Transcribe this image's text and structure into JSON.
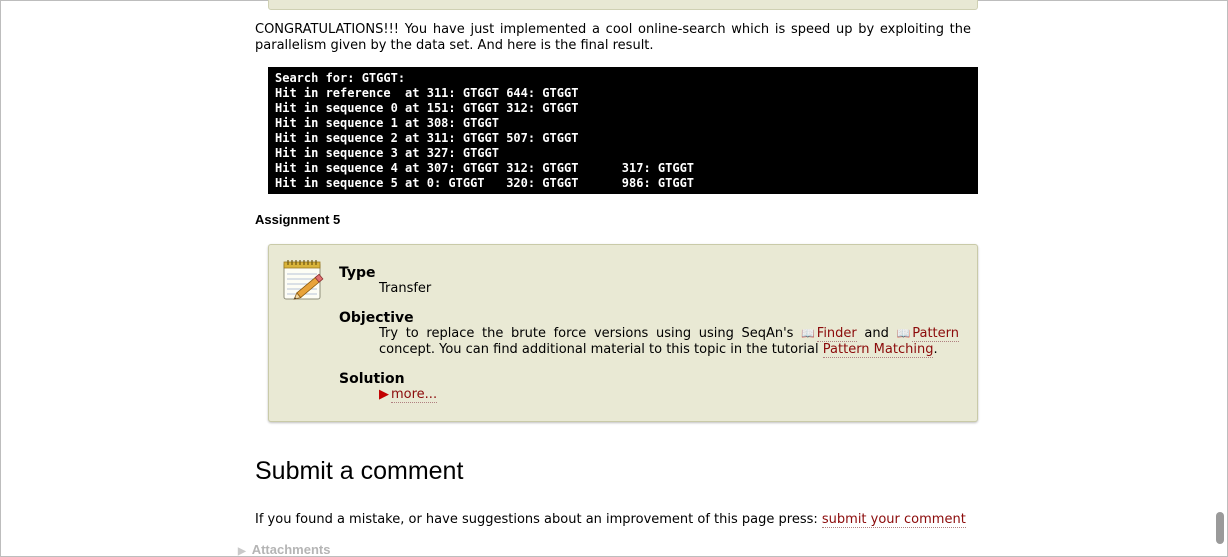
{
  "intro_paragraph": "CONGRATULATIONS!!! You have just implemented a cool online-search which is speed up by exploiting the parallelism given by the data set. And here is the final result.",
  "terminal": {
    "lines": [
      "Search for: GTGGT:",
      "Hit in reference  at 311: GTGGT 644: GTGGT",
      "Hit in sequence 0 at 151: GTGGT 312: GTGGT",
      "Hit in sequence 1 at 308: GTGGT",
      "Hit in sequence 2 at 311: GTGGT 507: GTGGT",
      "Hit in sequence 3 at 327: GTGGT",
      "Hit in sequence 4 at 307: GTGGT 312: GTGGT      317: GTGGT",
      "Hit in sequence 5 at 0: GTGGT   320: GTGGT      986: GTGGT"
    ]
  },
  "assignment": {
    "heading": "Assignment 5",
    "type_label": "Type",
    "type_value": "Transfer",
    "objective_label": "Objective",
    "objective_prefix": "Try to replace the brute force versions using using SeqAn's",
    "finder_link": "Finder",
    "and_text": "and",
    "pattern_link": "Pattern",
    "objective_middle": "concept. You can find additional material to this topic in the tutorial",
    "pattern_matching_link": "Pattern Matching",
    "objective_end": ".",
    "solution_label": "Solution",
    "more_link": "more...",
    "icon": "notepad-pencil-icon"
  },
  "comment_section": {
    "title": "Submit a comment",
    "text": "If you found a mistake, or have suggestions about an improvement of this page press:",
    "link": "submit your comment"
  },
  "attachments_label": "Attachments",
  "colors": {
    "link": "#8b0a0a",
    "box_bg": "#e9e9d4",
    "terminal_bg": "#000000"
  }
}
